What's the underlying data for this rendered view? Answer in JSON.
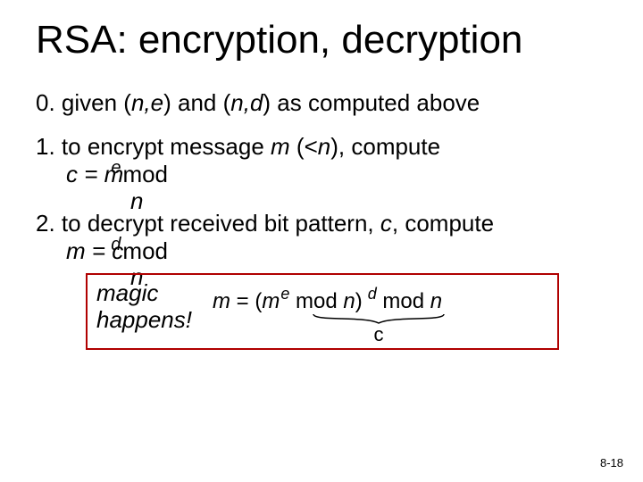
{
  "title": "RSA: encryption, decryption",
  "step0": {
    "label": "0.  given (",
    "n": "n,",
    "e": "e",
    "mid": ") and (",
    "n2": "n,",
    "d": "d",
    "tail": ") as computed above"
  },
  "step1": {
    "line": "1. to encrypt message ",
    "m": "m",
    "cond": " (<",
    "n": "n",
    "cond2": "), compute",
    "formula_c": "c = ",
    "formula_m": "m",
    "formula_e": "e",
    "mod": "  mod",
    "nline": "n"
  },
  "step2": {
    "line": "2. to decrypt received bit pattern, ",
    "c": "c",
    "tail": ", compute",
    "formula_m": "m = ",
    "formula_c": "c",
    "formula_d": "d",
    "mod": "  mod",
    "nline": "n"
  },
  "magic": {
    "left1": "magic",
    "left2": "happens!",
    "eq_m": "m",
    "eq_eq": "  =  (",
    "eq_m2": "m",
    "eq_e": "e",
    "eq_mod1": " mod ",
    "eq_n1": "n",
    "eq_close": ")",
    "eq_d": " d",
    "eq_mod2": " mod ",
    "eq_n2": "n",
    "c_label": "c"
  },
  "pagenum": "8-18"
}
